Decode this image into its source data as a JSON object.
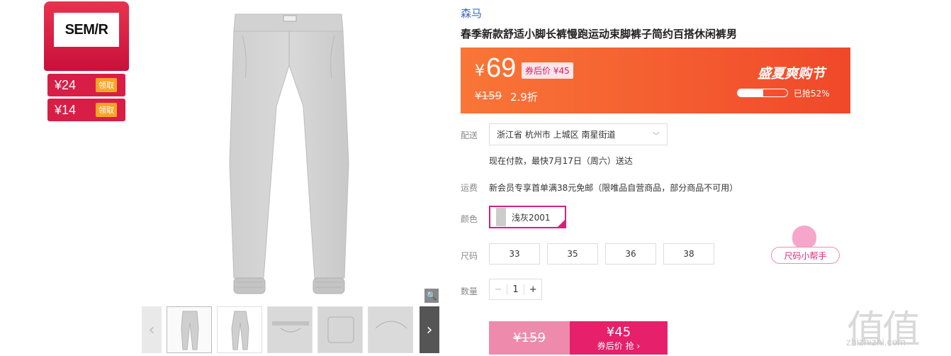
{
  "brand_card": {
    "logo": "SEM/R",
    "coupons": [
      {
        "amount": "¥24",
        "action": "领取"
      },
      {
        "amount": "¥14",
        "action": "领取"
      }
    ]
  },
  "product": {
    "brand": "森马",
    "title": "春季新款舒适小脚长裤慢跑运动束脚裤子简约百搭休闲裤男"
  },
  "price": {
    "currency": "¥",
    "current": "69",
    "after_coupon": "券后价 ¥45",
    "original": "¥159",
    "discount": "2.9折",
    "event": "盛夏爽购节",
    "sold_text": "已抢52%",
    "sold_percent": 52
  },
  "delivery": {
    "label": "配送",
    "address": "浙江省 杭州市 上城区 南星街道",
    "eta": "现在付款，最快7月17日（周六）送达"
  },
  "shipping": {
    "label": "运费",
    "text": "新会员专享首单满38元免邮（限唯品自营商品，部分商品不可用）"
  },
  "color": {
    "label": "颜色",
    "selected": "浅灰2001"
  },
  "size": {
    "label": "尺码",
    "options": [
      "33",
      "35",
      "36",
      "38"
    ],
    "helper": "尺码小帮手"
  },
  "quantity": {
    "label": "数量",
    "value": "1",
    "minus": "−",
    "plus": "+"
  },
  "buy": {
    "original": "¥159",
    "price": "¥45",
    "action": "券后价 抢 ›"
  },
  "gallery": {
    "prev": "‹",
    "next": "›",
    "zoom": "🔍"
  },
  "watermark": {
    "mark": "值值值",
    "url": "zhizhizhi.com"
  }
}
